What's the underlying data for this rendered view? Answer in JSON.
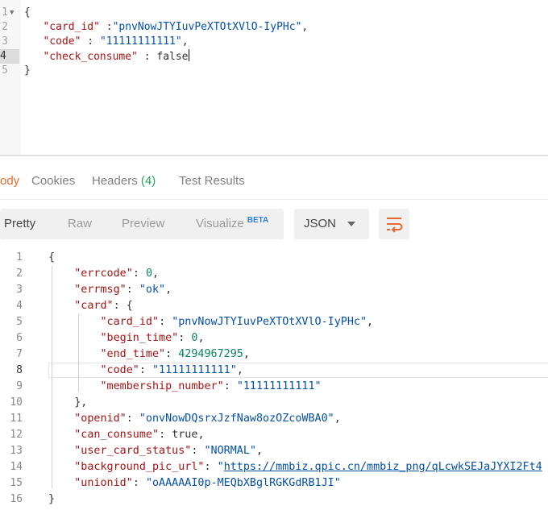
{
  "request_body": {
    "lines": [
      {
        "n": "1",
        "open": "{"
      },
      {
        "n": "2",
        "key": "\"card_id\"",
        "sep": " :",
        "val": "\"pnvNowJTYIuvPeXTOtXVlO-IyPHc\"",
        "tail": ","
      },
      {
        "n": "3",
        "key": "\"code\"",
        "sep": " : ",
        "val": "\"11111111111\"",
        "tail": ","
      },
      {
        "n": "4",
        "key": "\"check_consume\"",
        "sep": " : ",
        "val": "false",
        "tail": ""
      },
      {
        "n": "5",
        "open": "}"
      }
    ]
  },
  "tabs": {
    "body": "ody",
    "cookies": "Cookies",
    "headers": "Headers",
    "headers_count": "(4)",
    "test_results": "Test Results"
  },
  "toolbar": {
    "pretty": "Pretty",
    "raw": "Raw",
    "preview": "Preview",
    "visualize": "Visualize",
    "beta": "BETA",
    "format": "JSON",
    "wrap_icon": "wrap-lines-icon"
  },
  "response": {
    "line_numbers": [
      "1",
      "2",
      "3",
      "4",
      "5",
      "6",
      "7",
      "8",
      "9",
      "10",
      "11",
      "12",
      "13",
      "14",
      "15",
      "16"
    ],
    "errcode_key": "\"errcode\"",
    "errcode_val": "0",
    "errmsg_key": "\"errmsg\"",
    "errmsg_val": "\"ok\"",
    "card_key": "\"card\"",
    "card_id_key": "\"card_id\"",
    "card_id_val": "\"pnvNowJTYIuvPeXTOtXVlO-IyPHc\"",
    "begin_time_key": "\"begin_time\"",
    "begin_time_val": "0",
    "end_time_key": "\"end_time\"",
    "end_time_val": "4294967295",
    "code_key": "\"code\"",
    "code_val": "\"11111111111\"",
    "membership_key": "\"membership_number\"",
    "membership_val": "\"11111111111\"",
    "openid_key": "\"openid\"",
    "openid_val": "\"onvNowDQsrxJzfNaw8ozOZcoWBA0\"",
    "can_consume_key": "\"can_consume\"",
    "can_consume_val": "true",
    "status_key": "\"user_card_status\"",
    "status_val": "\"NORMAL\"",
    "bg_key": "\"background_pic_url\"",
    "bg_q": "\"",
    "bg_val": "https://mmbiz.qpic.cn/mmbiz_png/qLcwkSEJaJYXI2Ft4",
    "unionid_key": "\"unionid\"",
    "unionid_val": "\"oAAAAAI0p-MEQbXBglRGKGdRB1JI\""
  },
  "colors": {
    "accent": "#e8672e",
    "key": "#a31515",
    "string": "#0451a5",
    "number": "#098658",
    "count_green": "#26a65b"
  }
}
